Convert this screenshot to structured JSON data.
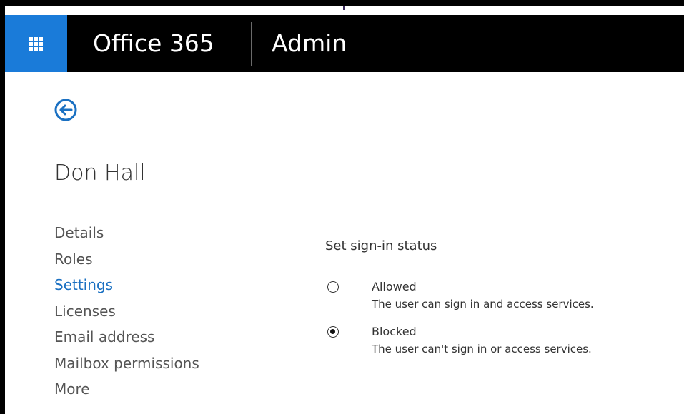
{
  "header": {
    "brand": "Office 365",
    "app_name": "Admin",
    "waffle_icon": "app-launcher-icon",
    "accent_color": "#1a7bd9"
  },
  "back": {
    "icon": "back-arrow-icon",
    "color": "#1a70c2"
  },
  "user": {
    "name": "Don Hall"
  },
  "nav": {
    "items": [
      {
        "label": "Details",
        "active": false
      },
      {
        "label": "Roles",
        "active": false
      },
      {
        "label": "Settings",
        "active": true
      },
      {
        "label": "Licenses",
        "active": false
      },
      {
        "label": "Email address",
        "active": false
      },
      {
        "label": "Mailbox permissions",
        "active": false
      },
      {
        "label": "More",
        "active": false
      }
    ],
    "active_color": "#1a70c2"
  },
  "signin": {
    "title": "Set sign-in status",
    "options": [
      {
        "label": "Allowed",
        "description": "The user can sign in and access services.",
        "checked": false
      },
      {
        "label": "Blocked",
        "description": "The user can't sign in or access services.",
        "checked": true
      }
    ]
  }
}
